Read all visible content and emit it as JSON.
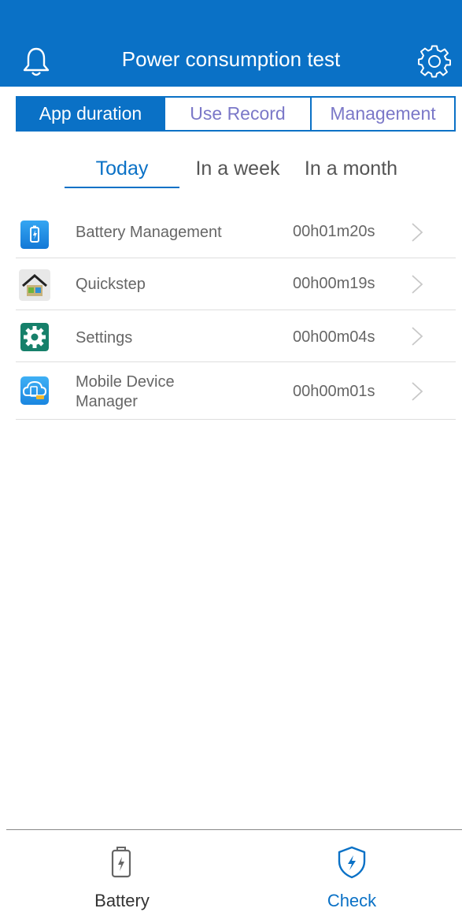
{
  "header": {
    "title": "Power consumption test",
    "left_icon": "bell-icon",
    "right_icon": "gear-icon"
  },
  "segments": [
    "App duration",
    "Use Record",
    "Management"
  ],
  "ranges": [
    "Today",
    "In a week",
    "In a month"
  ],
  "apps": [
    {
      "name": "Battery Management",
      "time": "00h01m20s",
      "icon": "battery-management-app-icon"
    },
    {
      "name": "Quickstep",
      "time": "00h00m19s",
      "icon": "quickstep-app-icon"
    },
    {
      "name": "Settings",
      "time": "00h00m04s",
      "icon": "settings-app-icon"
    },
    {
      "name_line1": "Mobile Device",
      "name_line2": "Manager",
      "time": "00h00m01s",
      "icon": "mobile-device-manager-app-icon"
    }
  ],
  "tabbar": {
    "battery_label": "Battery",
    "check_label": "Check"
  },
  "colors": {
    "accent": "#0a71c6",
    "inactive_segment_text": "#7b78c8",
    "text_gray": "#666666"
  }
}
